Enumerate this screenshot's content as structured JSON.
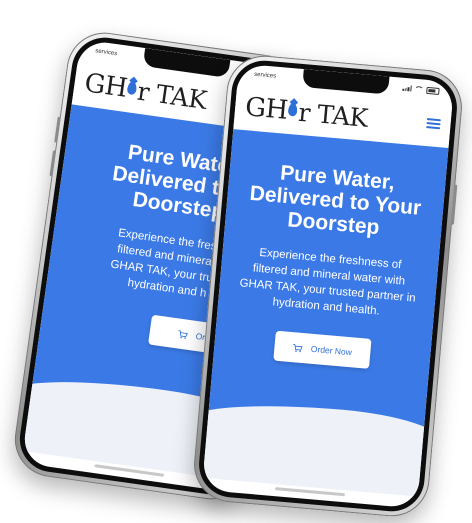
{
  "phones": [
    {
      "status": {
        "carrier": "services"
      },
      "logo": {
        "text_g": "GH",
        "text_rest": "r TAK"
      },
      "hero": {
        "title_line1": "Pure Water,",
        "title_line2": "Delivered to Y",
        "title_line3": "Doorstep",
        "desc_line1": "Experience the freshn",
        "desc_line2": "filtered and mineral w",
        "desc_line3": "GHAR TAK, your truste",
        "desc_line4": "hydration and h",
        "cta_label": "Order"
      }
    },
    {
      "status": {
        "carrier": "services"
      },
      "logo": {
        "text_g": "GH",
        "text_rest": "r TAK"
      },
      "hero": {
        "title_line1": "Pure Water,",
        "title_line2": "Delivered to Your",
        "title_line3": "Doorstep",
        "desc_line1": "Experience the freshness of",
        "desc_line2": "filtered and mineral water with",
        "desc_line3": "GHAR TAK, your trusted partner in",
        "desc_line4": "hydration and health.",
        "cta_label": "Order Now"
      }
    }
  ],
  "colors": {
    "brand_blue": "#3b7ae6",
    "background": "#ffffff"
  },
  "icons": {
    "cart": "shopping-cart-icon",
    "menu": "hamburger-menu-icon",
    "logo_drop": "water-drop-icon"
  }
}
